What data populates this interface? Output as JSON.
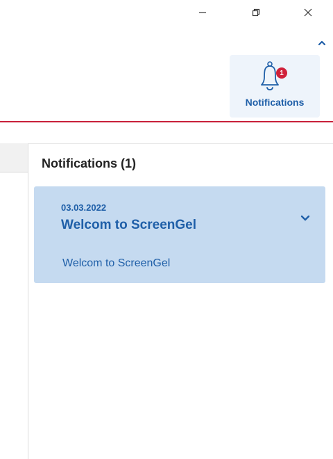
{
  "window": {
    "controls": [
      {
        "name": "minimize",
        "icon": "minimize-icon"
      },
      {
        "name": "restore",
        "icon": "restore-icon"
      },
      {
        "name": "close",
        "icon": "close-icon"
      }
    ]
  },
  "ribbon": {
    "collapse_icon": "chevron-up-icon",
    "notifications_button": {
      "label": "Notifications",
      "icon": "bell-icon",
      "badge_count": "1"
    }
  },
  "panel": {
    "title": "Notifications (1)",
    "notifications": [
      {
        "date": "03.03.2022",
        "title": "Welcom to ScreenGel",
        "body": "Welcom to ScreenGel",
        "expand_icon": "chevron-down-icon"
      }
    ]
  },
  "colors": {
    "accent_blue": "#1f5fa8",
    "card_background": "#c5daf0",
    "button_background": "#eef4fb",
    "badge_red": "#d0213a",
    "rule_red": "#c8203a"
  }
}
